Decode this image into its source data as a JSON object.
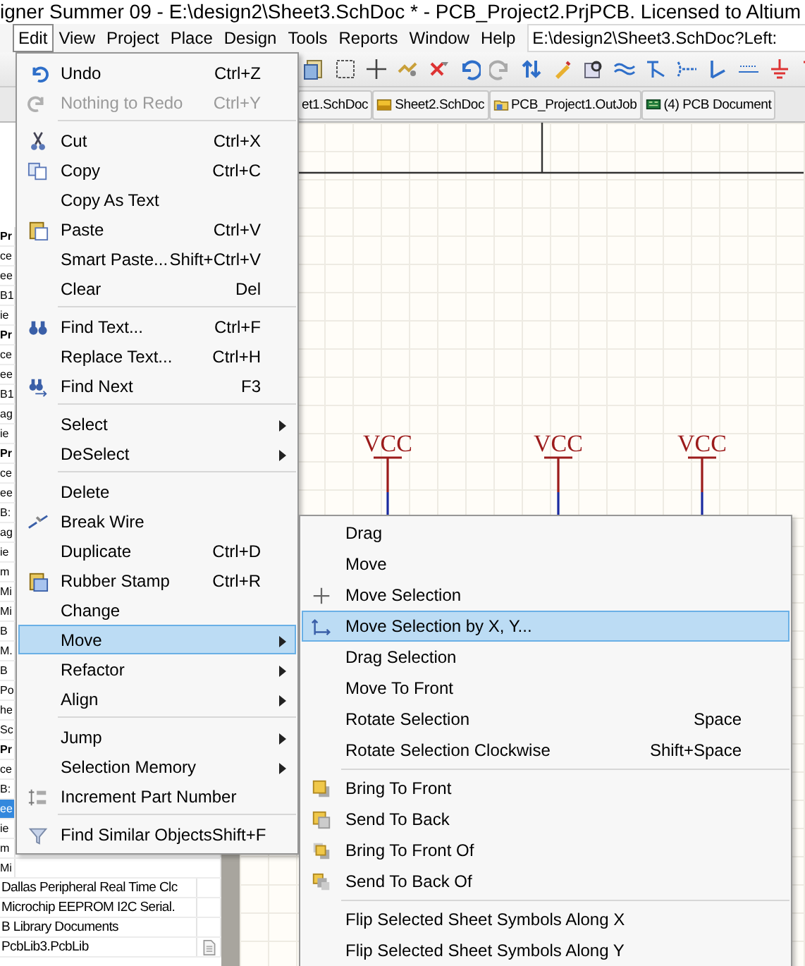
{
  "window": {
    "title": "igner Summer 09 - E:\\design2\\Sheet3.SchDoc * - PCB_Project2.PrjPCB. Licensed to Altium"
  },
  "menu_bar": {
    "items": [
      {
        "label": "Edit",
        "selected": true
      },
      {
        "label": "View",
        "selected": false
      },
      {
        "label": "Project",
        "selected": false
      },
      {
        "label": "Place",
        "selected": false
      },
      {
        "label": "Design",
        "selected": false
      },
      {
        "label": "Tools",
        "selected": false
      },
      {
        "label": "Reports",
        "selected": false
      },
      {
        "label": "Window",
        "selected": false
      },
      {
        "label": "Help",
        "selected": false
      }
    ],
    "path_field": "E:\\design2\\Sheet3.SchDoc?Left:"
  },
  "document_tabs": [
    {
      "label": "et1.SchDoc"
    },
    {
      "label": "Sheet2.SchDoc",
      "kind": "schematic"
    },
    {
      "label": "PCB_Project1.OutJob",
      "kind": "outjob"
    },
    {
      "label": "(4) PCB Document",
      "kind": "pcb"
    }
  ],
  "sidebar": {
    "items": [
      {
        "label": "Pr",
        "bold": true,
        "selected": false
      },
      {
        "label": "ce",
        "selected": false
      },
      {
        "label": "ee",
        "selected": false
      },
      {
        "label": "B1",
        "selected": false
      },
      {
        "label": "ie",
        "selected": false
      },
      {
        "label": "Pr",
        "bold": true,
        "selected": false
      },
      {
        "label": "ce",
        "selected": false
      },
      {
        "label": "ee",
        "selected": false
      },
      {
        "label": "B1",
        "selected": false
      },
      {
        "label": "ag",
        "selected": false
      },
      {
        "label": "ie",
        "selected": false
      },
      {
        "label": "Pr",
        "bold": true,
        "selected": false
      },
      {
        "label": "ce",
        "selected": false
      },
      {
        "label": "ee",
        "selected": false
      },
      {
        "label": "B:",
        "selected": false
      },
      {
        "label": "ag",
        "selected": false
      },
      {
        "label": "ie",
        "selected": false
      },
      {
        "label": "m",
        "selected": false
      },
      {
        "label": "Mi",
        "selected": false
      },
      {
        "label": "Mi",
        "selected": false
      },
      {
        "label": "B",
        "selected": false
      },
      {
        "label": "M.",
        "selected": false
      },
      {
        "label": "B",
        "selected": false
      },
      {
        "label": "Po",
        "selected": false
      },
      {
        "label": "he",
        "selected": false
      },
      {
        "label": "Sc",
        "selected": false
      },
      {
        "label": "Pr",
        "bold": true,
        "selected": false
      },
      {
        "label": "ce",
        "selected": false
      },
      {
        "label": "B:",
        "selected": false
      },
      {
        "label": "ee",
        "selected": true
      },
      {
        "label": "ie",
        "selected": false
      },
      {
        "label": "m",
        "selected": false
      },
      {
        "label": "Mi",
        "selected": false
      },
      {
        "label": "Dallas Peripheral Real Time Clc",
        "selected": false
      },
      {
        "label": "Microchip EEPROM I2C Serial.",
        "selected": false
      },
      {
        "label": "B Library Documents",
        "selected": false
      },
      {
        "label": "PcbLib3.PcbLib",
        "selected": false,
        "file_icon": true
      }
    ]
  },
  "schematic": {
    "power_ports": [
      {
        "label": "VCC"
      },
      {
        "label": "VCC"
      },
      {
        "label": "VCC"
      }
    ]
  },
  "edit_menu": {
    "items": [
      {
        "kind": "item",
        "label": "Undo",
        "shortcut": "Ctrl+Z",
        "disabled": false,
        "submenu": false,
        "selected": false
      },
      {
        "kind": "item",
        "label": "Nothing to Redo",
        "shortcut": "Ctrl+Y",
        "disabled": true,
        "submenu": false,
        "selected": false
      },
      {
        "kind": "separator"
      },
      {
        "kind": "item",
        "label": "Cut",
        "shortcut": "Ctrl+X",
        "disabled": false,
        "submenu": false,
        "selected": false
      },
      {
        "kind": "item",
        "label": "Copy",
        "shortcut": "Ctrl+C",
        "disabled": false,
        "submenu": false,
        "selected": false
      },
      {
        "kind": "item",
        "label": "Copy As Text",
        "disabled": false,
        "submenu": false,
        "selected": false
      },
      {
        "kind": "item",
        "label": "Paste",
        "shortcut": "Ctrl+V",
        "disabled": false,
        "submenu": false,
        "selected": false
      },
      {
        "kind": "item",
        "label": "Smart Paste...",
        "shortcut": "Shift+Ctrl+V",
        "disabled": false,
        "submenu": false,
        "selected": false
      },
      {
        "kind": "item",
        "label": "Clear",
        "shortcut": "Del",
        "disabled": false,
        "submenu": false,
        "selected": false
      },
      {
        "kind": "separator"
      },
      {
        "kind": "item",
        "label": "Find Text...",
        "shortcut": "Ctrl+F",
        "disabled": false,
        "submenu": false,
        "selected": false
      },
      {
        "kind": "item",
        "label": "Replace Text...",
        "shortcut": "Ctrl+H",
        "disabled": false,
        "submenu": false,
        "selected": false
      },
      {
        "kind": "item",
        "label": "Find Next",
        "shortcut": "F3",
        "disabled": false,
        "submenu": false,
        "selected": false
      },
      {
        "kind": "separator"
      },
      {
        "kind": "item",
        "label": "Select",
        "disabled": false,
        "submenu": true,
        "selected": false
      },
      {
        "kind": "item",
        "label": "DeSelect",
        "disabled": false,
        "submenu": true,
        "selected": false
      },
      {
        "kind": "separator"
      },
      {
        "kind": "item",
        "label": "Delete",
        "disabled": false,
        "submenu": false,
        "selected": false
      },
      {
        "kind": "item",
        "label": "Break Wire",
        "disabled": false,
        "submenu": false,
        "selected": false
      },
      {
        "kind": "item",
        "label": "Duplicate",
        "shortcut": "Ctrl+D",
        "disabled": false,
        "submenu": false,
        "selected": false
      },
      {
        "kind": "item",
        "label": "Rubber Stamp",
        "shortcut": "Ctrl+R",
        "disabled": false,
        "submenu": false,
        "selected": false
      },
      {
        "kind": "item",
        "label": "Change",
        "disabled": false,
        "submenu": false,
        "selected": false
      },
      {
        "kind": "item",
        "label": "Move",
        "disabled": false,
        "submenu": true,
        "selected": true
      },
      {
        "kind": "item",
        "label": "Refactor",
        "disabled": false,
        "submenu": true,
        "selected": false
      },
      {
        "kind": "item",
        "label": "Align",
        "disabled": false,
        "submenu": true,
        "selected": false
      },
      {
        "kind": "separator"
      },
      {
        "kind": "item",
        "label": "Jump",
        "disabled": false,
        "submenu": true,
        "selected": false
      },
      {
        "kind": "item",
        "label": "Selection Memory",
        "disabled": false,
        "submenu": true,
        "selected": false
      },
      {
        "kind": "item",
        "label": "Increment Part Number",
        "disabled": false,
        "submenu": false,
        "selected": false
      },
      {
        "kind": "separator"
      },
      {
        "kind": "item",
        "label": "Find Similar Objects",
        "shortcut": "Shift+F",
        "disabled": false,
        "submenu": false,
        "selected": false
      }
    ]
  },
  "move_submenu": {
    "items": [
      {
        "kind": "item",
        "label": "Drag",
        "selected": false
      },
      {
        "kind": "item",
        "label": "Move",
        "selected": false
      },
      {
        "kind": "item",
        "label": "Move Selection",
        "selected": false
      },
      {
        "kind": "item",
        "label": "Move Selection by X, Y...",
        "selected": true
      },
      {
        "kind": "item",
        "label": "Drag Selection",
        "selected": false
      },
      {
        "kind": "item",
        "label": "Move To Front",
        "selected": false
      },
      {
        "kind": "item",
        "label": "Rotate Selection",
        "shortcut": "Space",
        "selected": false
      },
      {
        "kind": "item",
        "label": "Rotate Selection Clockwise",
        "shortcut": "Shift+Space",
        "selected": false
      },
      {
        "kind": "separator"
      },
      {
        "kind": "item",
        "label": "Bring To Front",
        "selected": false
      },
      {
        "kind": "item",
        "label": "Send To Back",
        "selected": false
      },
      {
        "kind": "item",
        "label": "Bring To Front Of",
        "selected": false
      },
      {
        "kind": "item",
        "label": "Send To Back Of",
        "selected": false
      },
      {
        "kind": "separator"
      },
      {
        "kind": "item",
        "label": "Flip Selected Sheet Symbols Along X",
        "selected": false
      },
      {
        "kind": "item",
        "label": "Flip Selected Sheet Symbols Along Y",
        "selected": false
      }
    ]
  }
}
